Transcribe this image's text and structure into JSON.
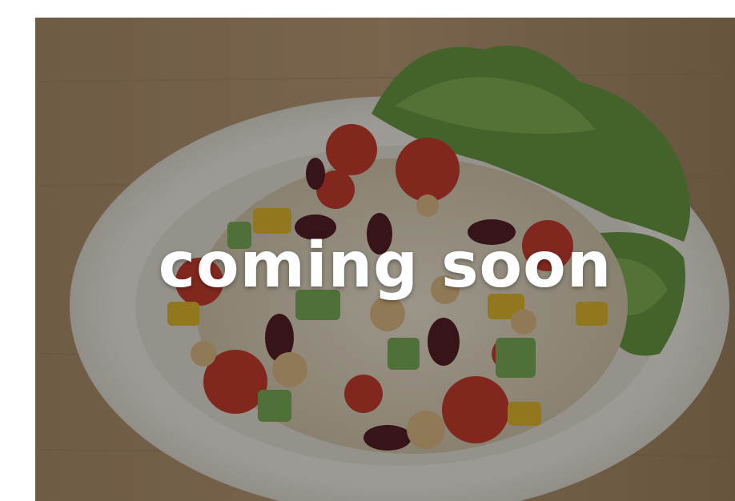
{
  "banner": {
    "message": "coming soon",
    "image_subject": "salad-plate"
  },
  "colors": {
    "page_background": "#ffffff",
    "overlay_text": "#ffffff"
  }
}
